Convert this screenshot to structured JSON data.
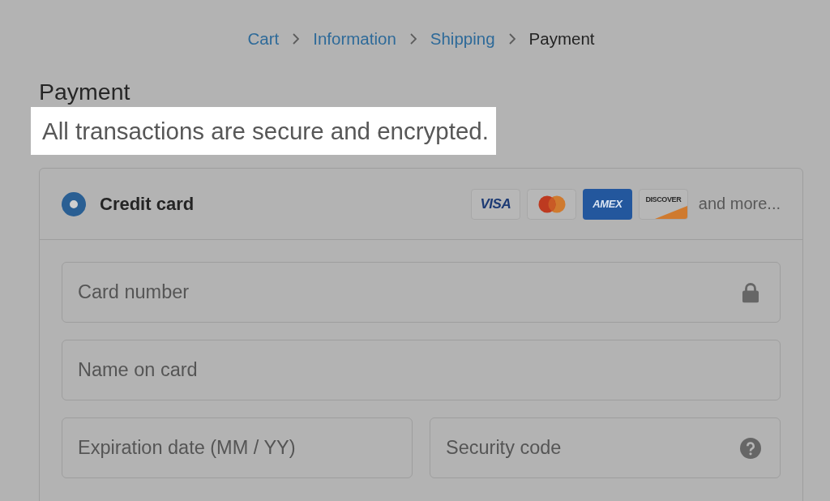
{
  "breadcrumb": [
    {
      "label": "Cart",
      "selected": false
    },
    {
      "label": "Information",
      "selected": false
    },
    {
      "label": "Shipping",
      "selected": false
    },
    {
      "label": "Payment",
      "selected": true
    }
  ],
  "section": {
    "title": "Payment",
    "notice": {
      "text": "All transactions are secure and encrypted.",
      "highlighted": true
    }
  },
  "payment_method": {
    "label": "Credit card",
    "selected": true,
    "card_brands": [
      {
        "kind": "visa",
        "label": "VISA"
      },
      {
        "kind": "mastercard"
      },
      {
        "kind": "amex",
        "label": "AMEX"
      },
      {
        "kind": "discover",
        "label": "DISCOVER"
      }
    ],
    "more": "and more..."
  },
  "field_rows": [
    [
      {
        "kind": "card_number",
        "placeholder": "Card number"
      }
    ],
    [
      {
        "kind": "text",
        "placeholder": "Name on card"
      }
    ],
    [
      {
        "kind": "text",
        "placeholder": "Expiration date (MM / YY)"
      },
      {
        "kind": "security_code",
        "placeholder": "Security code"
      }
    ]
  ]
}
